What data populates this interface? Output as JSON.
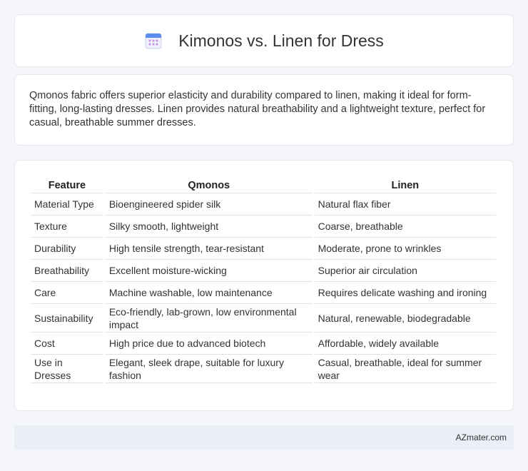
{
  "header": {
    "title": "Kimonos vs. Linen for Dress",
    "icon": "calendar-icon"
  },
  "summary": "Qmonos fabric offers superior elasticity and durability compared to linen, making it ideal for form-fitting, long-lasting dresses. Linen provides natural breathability and a lightweight texture, perfect for casual, breathable summer dresses.",
  "table": {
    "headers": [
      "Feature",
      "Qmonos",
      "Linen"
    ],
    "rows": [
      [
        "Material Type",
        "Bioengineered spider silk",
        "Natural flax fiber"
      ],
      [
        "Texture",
        "Silky smooth, lightweight",
        "Coarse, breathable"
      ],
      [
        "Durability",
        "High tensile strength, tear-resistant",
        "Moderate, prone to wrinkles"
      ],
      [
        "Breathability",
        "Excellent moisture-wicking",
        "Superior air circulation"
      ],
      [
        "Care",
        "Machine washable, low maintenance",
        "Requires delicate washing and ironing"
      ],
      [
        "Sustainability",
        "Eco-friendly, lab-grown, low environmental impact",
        "Natural, renewable, biodegradable"
      ],
      [
        "Cost",
        "High price due to advanced biotech",
        "Affordable, widely available"
      ],
      [
        "Use in Dresses",
        "Elegant, sleek drape, suitable for luxury fashion",
        "Casual, breathable, ideal for summer wear"
      ]
    ]
  },
  "footer": {
    "brand": "AZmater.com"
  },
  "colors": {
    "background": "#f4f6fa",
    "footer_bg": "#e9eef7",
    "icon_top": "#5b8def",
    "icon_dots": "#c58fe0"
  }
}
